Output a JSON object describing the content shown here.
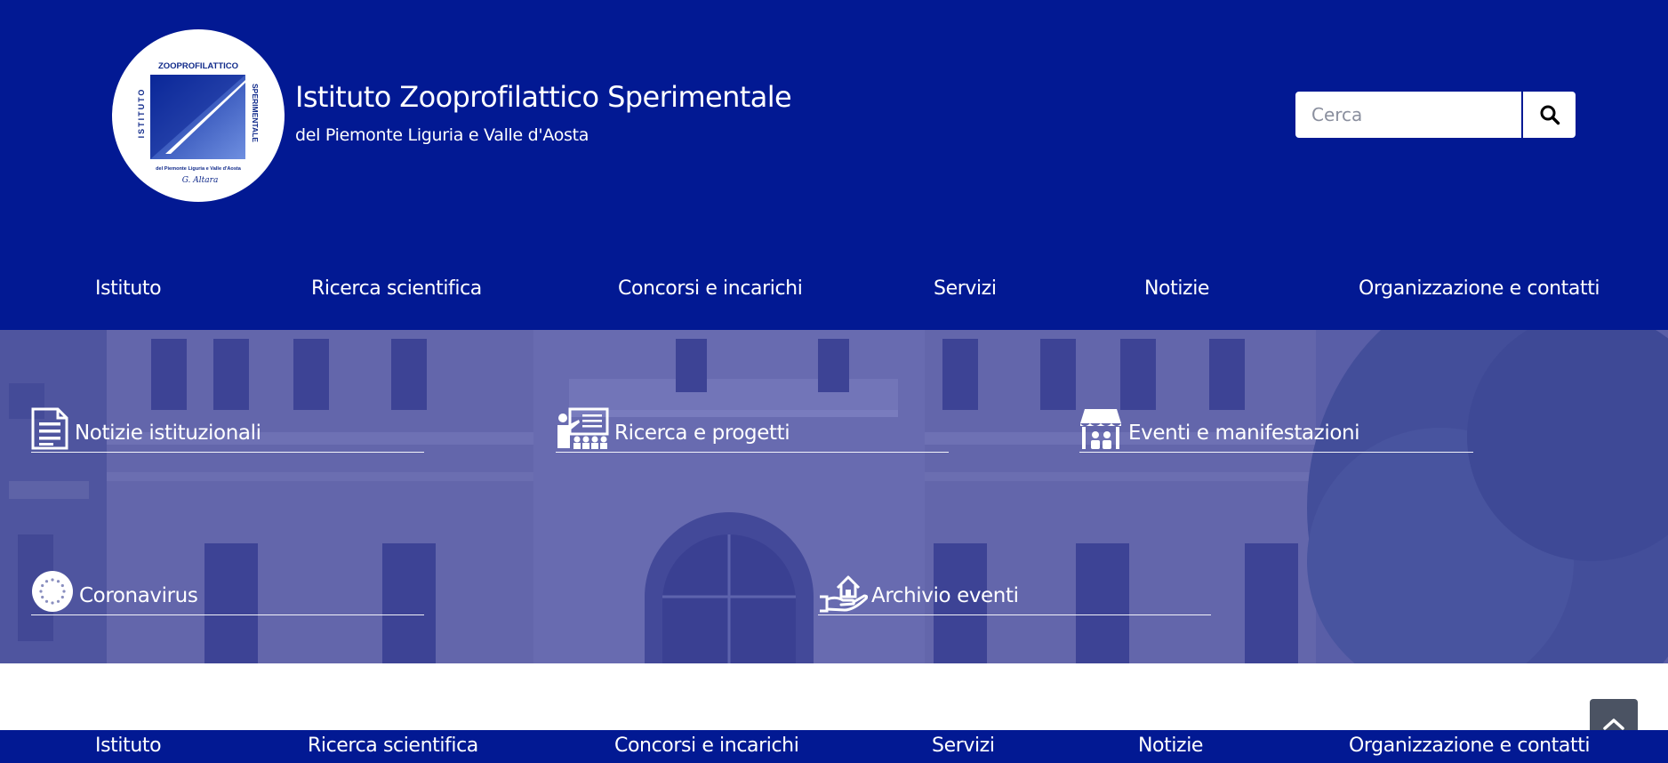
{
  "header": {
    "title": "Istituto Zooprofilattico Sperimentale",
    "subtitle": "del Piemonte Liguria e Valle d'Aosta",
    "logo": {
      "top_text": "ZOOPROFILATTICO",
      "left_text": "ISTITUTO",
      "right_text": "SPERIMENTALE",
      "bottom_text": "del Piemonte Liguria e Valle d'Aosta",
      "signature": "G. Altara"
    },
    "search": {
      "placeholder": "Cerca",
      "icon": "search-icon"
    }
  },
  "nav": {
    "items": [
      {
        "label": "Istituto"
      },
      {
        "label": "Ricerca scientifica"
      },
      {
        "label": "Concorsi e incarichi"
      },
      {
        "label": "Servizi"
      },
      {
        "label": "Notizie"
      },
      {
        "label": "Organizzazione e contatti"
      }
    ]
  },
  "hero": {
    "tiles": [
      {
        "label": "Notizie istituzionali",
        "icon": "document-icon"
      },
      {
        "label": "Ricerca e progetti",
        "icon": "presentation-icon"
      },
      {
        "label": "Eventi e manifestazioni",
        "icon": "market-stall-icon"
      },
      {
        "label": "Coronavirus",
        "icon": "eu-stars-icon"
      },
      {
        "label": "Archivio eventi",
        "icon": "hand-house-icon"
      }
    ]
  },
  "footer_nav": {
    "items": [
      {
        "label": "Istituto"
      },
      {
        "label": "Ricerca scientifica"
      },
      {
        "label": "Concorsi e incarichi"
      },
      {
        "label": "Servizi"
      },
      {
        "label": "Notizie"
      },
      {
        "label": "Organizzazione e contatti"
      }
    ]
  },
  "back_to_top": {
    "icon": "chevron-up-icon"
  },
  "colors": {
    "brand_blue": "#021993",
    "hero_overlay": "#5a62a0",
    "white": "#ffffff",
    "back_to_top_bg": "#4b5363"
  }
}
